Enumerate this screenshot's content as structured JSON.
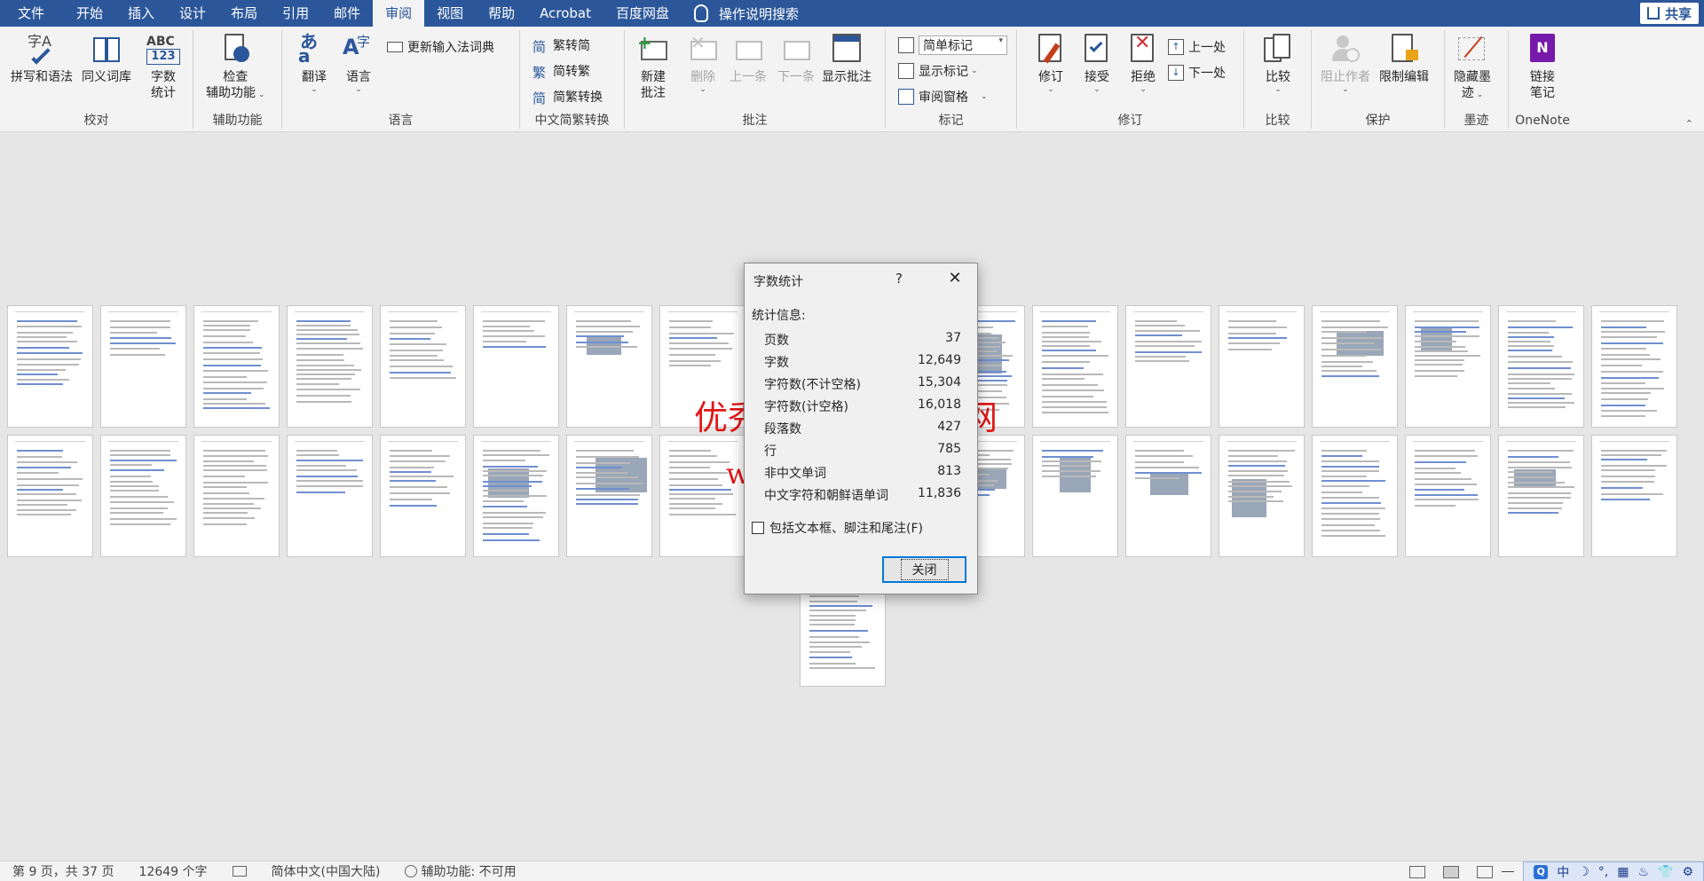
{
  "menu": {
    "tabs": [
      "文件",
      "开始",
      "插入",
      "设计",
      "布局",
      "引用",
      "邮件",
      "审阅",
      "视图",
      "帮助",
      "Acrobat",
      "百度网盘"
    ],
    "active_index": 7,
    "tell_me": "操作说明搜索",
    "share": "共享"
  },
  "ribbon": {
    "proofing": {
      "label": "校对",
      "spelling": "拼写和语法",
      "thesaurus": "同义词库",
      "wordcount_line1": "字数",
      "wordcount_line2": "统计",
      "abc_text": "ABC",
      "num_text": "123"
    },
    "accessibility": {
      "label": "辅助功能",
      "check_line1": "检查",
      "check_line2": "辅助功能"
    },
    "language": {
      "label": "语言",
      "translate": "翻译",
      "language": "语言",
      "update_ime": "更新输入法词典"
    },
    "chinese_conversion": {
      "label": "中文简繁转换",
      "to_simplified": "繁转简",
      "to_traditional": "简转繁",
      "convert": "简繁转换"
    },
    "comments": {
      "label": "批注",
      "new_line1": "新建",
      "new_line2": "批注",
      "delete": "删除",
      "previous": "上一条",
      "next": "下一条",
      "show": "显示批注"
    },
    "tracking": {
      "label": "标记",
      "markup_select": "简单标记",
      "show_markup": "显示标记",
      "reviewing_pane": "审阅窗格"
    },
    "changes": {
      "label": "修订",
      "track": "修订",
      "accept": "接受",
      "reject": "拒绝",
      "previous": "上一处",
      "next": "下一处"
    },
    "compare": {
      "label": "比较",
      "compare": "比较"
    },
    "protect": {
      "label": "保护",
      "block_authors": "阻止作者",
      "restrict": "限制编辑"
    },
    "ink": {
      "label": "墨迹",
      "hide_line1": "隐藏墨",
      "hide_line2": "迹"
    },
    "onenote": {
      "label": "OneNote",
      "link_line1": "链接",
      "link_line2": "笔记"
    }
  },
  "watermark": {
    "line1": "优秀毕业设计资源网",
    "line2": "www.keyicad.cn"
  },
  "dialog": {
    "title": "字数统计",
    "help": "?",
    "section": "统计信息:",
    "stats": [
      {
        "label": "页数",
        "value": "37"
      },
      {
        "label": "字数",
        "value": "12,649"
      },
      {
        "label": "字符数(不计空格)",
        "value": "15,304"
      },
      {
        "label": "字符数(计空格)",
        "value": "16,018"
      },
      {
        "label": "段落数",
        "value": "427"
      },
      {
        "label": "行",
        "value": "785"
      },
      {
        "label": "非中文单词",
        "value": "813"
      },
      {
        "label": "中文字符和朝鲜语单词",
        "value": "11,836"
      }
    ],
    "include_label": "包括文本框、脚注和尾注(F)",
    "close_button": "关闭"
  },
  "statusbar": {
    "page": "第 9 页，共 37 页",
    "words": "12649 个字",
    "language": "简体中文(中国大陆)",
    "accessibility": "辅助功能: 不可用",
    "ime_items": [
      "中",
      "☽",
      "°,",
      "▦",
      "♨",
      "👕",
      "⚙"
    ]
  },
  "colors": {
    "accent": "#2b579a",
    "ribbon_bg": "#f3f3f3",
    "canvas_bg": "#e6e6e6",
    "watermark": "#e01818"
  }
}
